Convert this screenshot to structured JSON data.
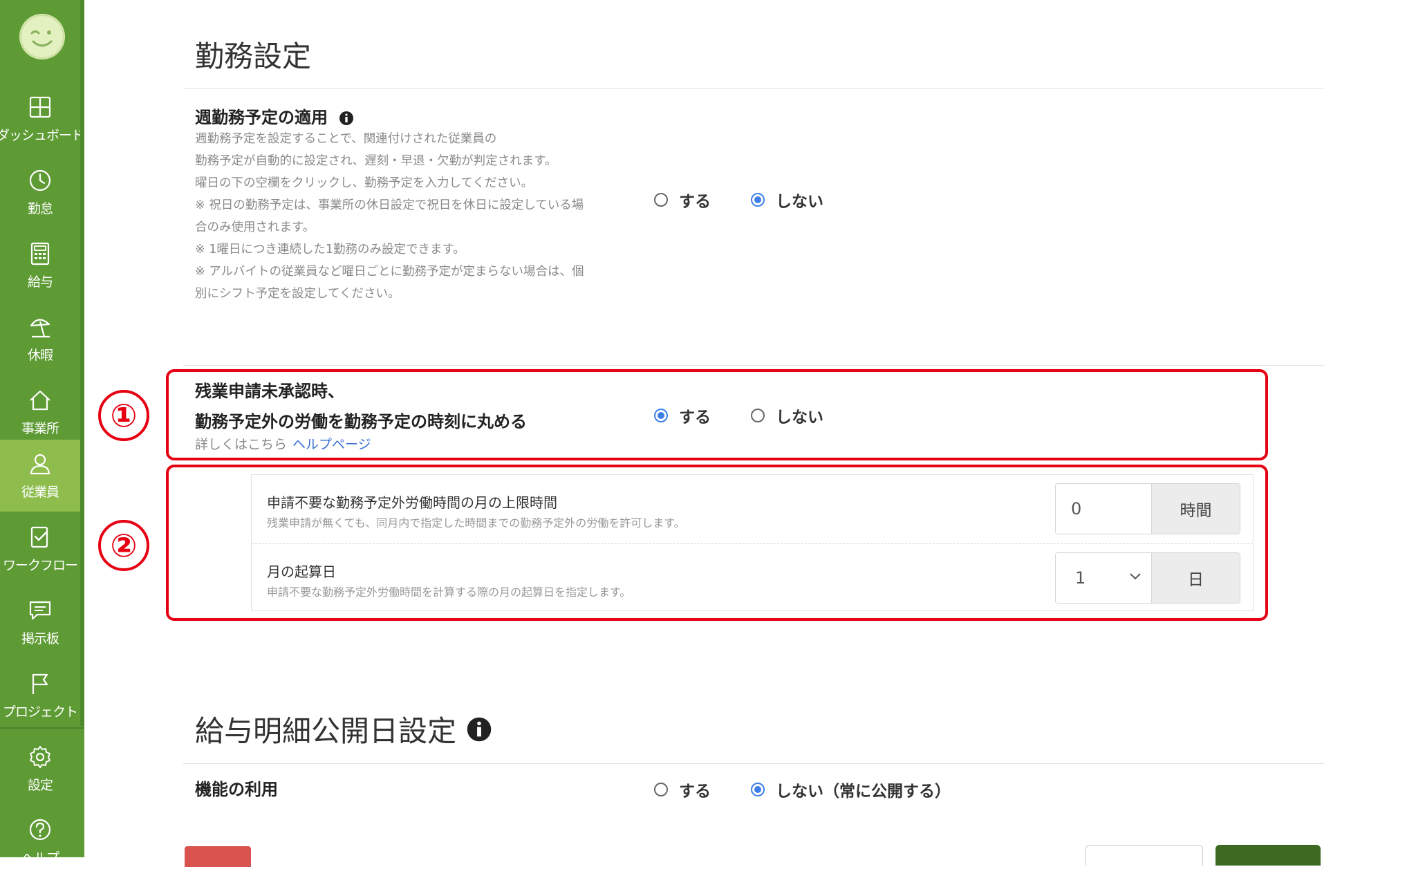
{
  "colors": {
    "sidebar": "#5e9b35",
    "sidebar_active": "#8ebd4e",
    "radio_checked": "#3d7fe6",
    "annotation": "#e60012",
    "link": "#3b72d6"
  },
  "sidebar": {
    "items": [
      {
        "label": "ダッシュボード",
        "icon": "dashboard-icon"
      },
      {
        "label": "勤怠",
        "icon": "clock-icon"
      },
      {
        "label": "給与",
        "icon": "calculator-icon"
      },
      {
        "label": "休暇",
        "icon": "beach-umbrella-icon"
      },
      {
        "label": "事業所",
        "icon": "home-icon"
      },
      {
        "label": "従業員",
        "icon": "person-icon",
        "active": true
      },
      {
        "label": "ワークフロー",
        "icon": "workflow-icon"
      },
      {
        "label": "掲示板",
        "icon": "chat-icon"
      },
      {
        "label": "プロジェクト",
        "icon": "flag-icon"
      },
      {
        "label": "設定",
        "icon": "gear-icon"
      },
      {
        "label": "ヘルプ",
        "icon": "help-icon"
      }
    ]
  },
  "page": {
    "title": "勤務設定"
  },
  "weekly": {
    "title": "週勤務予定の適用",
    "description": [
      "週勤務予定を設定することで、関連付けされた従業員の",
      "勤務予定が自動的に設定され、遅刻・早退・欠勤が判定されます。",
      "曜日の下の空欄をクリックし、勤務予定を入力してください。",
      "※ 祝日の勤務予定は、事業所の休日設定で祝日を休日に設定している場",
      "合のみ使用されます。",
      "※ 1曜日につき連続した1勤務のみ設定できます。",
      "※ アルバイトの従業員など曜日ごとに勤務予定が定まらない場合は、個",
      "別にシフト予定を設定してください。"
    ],
    "option_yes": "する",
    "option_no": "しない",
    "selected": "no"
  },
  "overtime": {
    "title_line1": "残業申請未承認時、",
    "title_line2": "勤務予定外の労働を勤務予定の時刻に丸める",
    "help_text": "詳しくはこちら",
    "help_link": "ヘルプページ",
    "option_yes": "する",
    "option_no": "しない",
    "selected": "yes"
  },
  "annotations": {
    "marker1": "①",
    "marker2": "②"
  },
  "limit": {
    "label": "申請不要な勤務予定外労働時間の月の上限時間",
    "sub": "残業申請が無くても、同月内で指定した時間までの勤務予定外の労働を許可します。",
    "value": "0",
    "unit": "時間"
  },
  "start_day": {
    "label": "月の起算日",
    "sub": "申請不要な勤務予定外労働時間を計算する際の月の起算日を指定します。",
    "value": "1",
    "unit": "日"
  },
  "payslip": {
    "title": "給与明細公開日設定",
    "func_label": "機能の利用",
    "option_yes": "する",
    "option_no": "しない（常に公開する）",
    "selected": "no"
  }
}
